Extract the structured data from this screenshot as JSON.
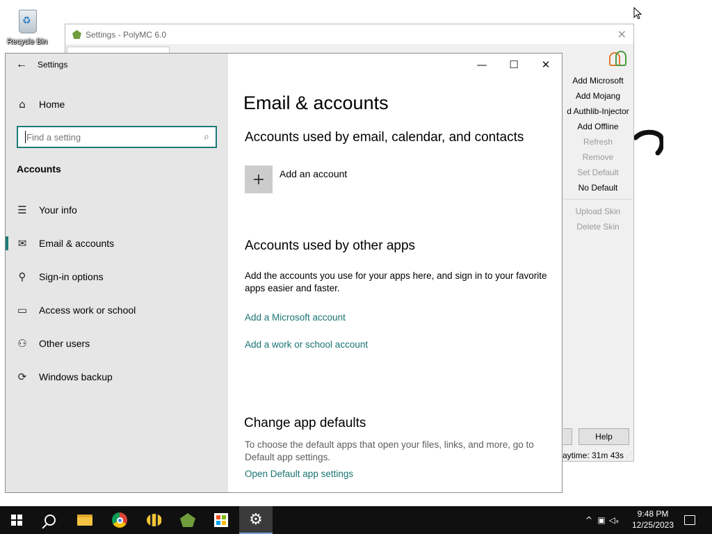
{
  "desktop": {
    "recycle_bin_label": "Recycle Bin"
  },
  "polymc": {
    "title": "Settings - PolyMC 6.0",
    "buttons": [
      {
        "label": "Add Microsoft",
        "enabled": true
      },
      {
        "label": "Add Mojang",
        "enabled": true
      },
      {
        "label": "d Authlib-Injector",
        "enabled": true
      },
      {
        "label": "Add Offline",
        "enabled": true
      },
      {
        "label": "Refresh",
        "enabled": false
      },
      {
        "label": "Remove",
        "enabled": false
      },
      {
        "label": "Set Default",
        "enabled": false
      },
      {
        "label": "No Default",
        "enabled": true
      },
      {
        "label": "Upload Skin",
        "enabled": false
      },
      {
        "label": "Delete Skin",
        "enabled": false
      }
    ],
    "help_label": "Help",
    "playtime": "aytime: 31m 43s"
  },
  "settings": {
    "window_title": "Settings",
    "home_label": "Home",
    "search_placeholder": "Find a setting",
    "section_label": "Accounts",
    "nav_items": [
      {
        "label": "Your info",
        "icon": "person-card-icon"
      },
      {
        "label": "Email & accounts",
        "icon": "mail-icon",
        "active": true
      },
      {
        "label": "Sign-in options",
        "icon": "key-icon"
      },
      {
        "label": "Access work or school",
        "icon": "briefcase-icon"
      },
      {
        "label": "Other users",
        "icon": "person-add-icon"
      },
      {
        "label": "Windows backup",
        "icon": "sync-icon"
      }
    ],
    "page_title": "Email & accounts",
    "email_section": {
      "heading": "Accounts used by email, calendar, and contacts",
      "add_account": "Add an account"
    },
    "other_apps_section": {
      "heading": "Accounts used by other apps",
      "description": "Add the accounts you use for your apps here, and sign in to your favorite apps easier and faster.",
      "link_microsoft": "Add a Microsoft account",
      "link_work": "Add a work or school account"
    },
    "defaults_section": {
      "heading": "Change app defaults",
      "description": "To choose the default apps that open your files, links, and more, go to Default app settings.",
      "link": "Open Default app settings"
    },
    "accent_color": "#1e7a78"
  },
  "taskbar": {
    "time": "9:48 PM",
    "date": "12/25/2023",
    "apps": [
      "start-icon",
      "search-icon",
      "file-explorer-icon",
      "chrome-icon",
      "bee-app-icon",
      "polymc-icon",
      "store-icon",
      "settings-gear-icon"
    ]
  }
}
